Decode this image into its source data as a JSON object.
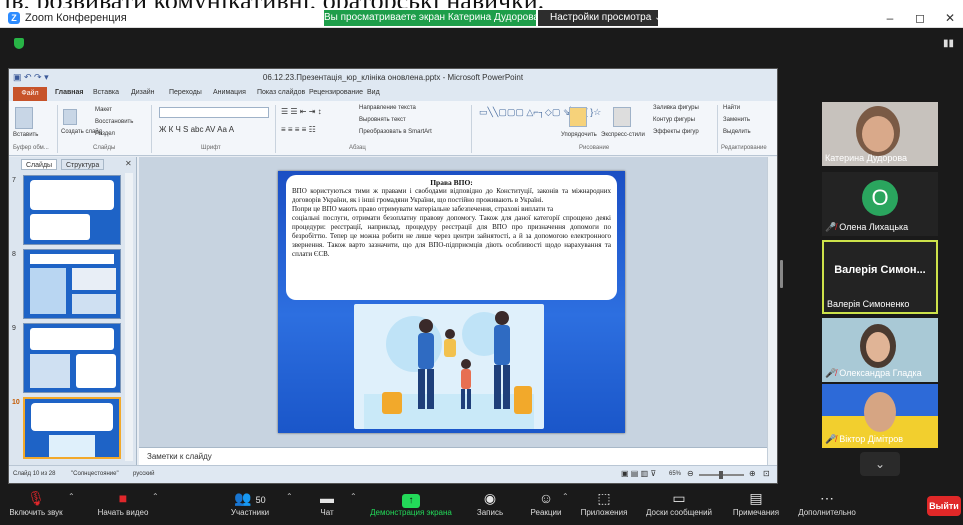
{
  "caption_text": "ів, розвивати комунікативні, ораторські навички.",
  "zoom": {
    "title": "Zoom Конференция",
    "share_banner": "Вы просматриваете экран Катерина Дудорова",
    "view_options": "Настройки просмотра",
    "window_controls": [
      "–",
      "◻",
      "✕"
    ]
  },
  "ppt": {
    "filename": "06.12.23.Презентація_юр_клінікa оновлена.pptx - Microsoft PowerPoint",
    "tabs": [
      "Файл",
      "Главная",
      "Вставка",
      "Дизайн",
      "Переходы",
      "Анимация",
      "Показ слайдов",
      "Рецензирование",
      "Вид"
    ],
    "ribbon": {
      "groups": [
        "Буфер обм...",
        "Слайды",
        "Шрифт",
        "Абзац",
        "Рисование",
        "Редактирование"
      ],
      "items": {
        "paste": "Вставить",
        "create_slide": "Создать слайд",
        "layout": "Макет",
        "reset": "Восстановить",
        "section": "Раздел",
        "text_direction": "Направление текста",
        "align_text": "Выровнять текст",
        "smartart": "Преобразовать в SmartArt",
        "arrange": "Упорядочить",
        "quick_styles": "Экспресс-стили",
        "shape_fill": "Заливка фигуры",
        "shape_outline": "Контур фигуры",
        "shape_effects": "Эффекты фигур",
        "find": "Найти",
        "replace": "Заменить",
        "select": "Выделить"
      }
    },
    "pane_tabs": [
      "Слайды",
      "Структура"
    ],
    "thumb_numbers": [
      "7",
      "8",
      "9",
      "10"
    ],
    "slide": {
      "title": "Права ВПО:",
      "paragraph1": "ВПО користуються тими ж правами і свободами відповідно до Конституції, законів та міжнародних договорів України, як і інші громадяни України, що постійно проживають в Україні.",
      "paragraph2": "Попри це ВПО мають право отримувати матеріальне забезпечення, страхові виплати та",
      "paragraph3": "соціальні послуги, отримати безоплатну правову допомогу. Також для даної категорії спрощено деякі процедури: реєстрації, наприклад, процедуру реєстрації для ВПО про призначення допомоги по безробіттю. Тепер це можна робити не лише через центри зайнятості, а й за допомогою електронного звернення. Також варто зазначити, що для ВПО-підприємців діють особливості щодо нарахування та сплати ЄСВ."
    },
    "notes_placeholder": "Заметки к слайду",
    "status": {
      "slide_counter": "Слайд 10 из 28",
      "theme": "\"Солнцестояние\"",
      "language": "русский",
      "zoom": "65%"
    }
  },
  "participants": [
    {
      "name": "Катерина Дудорова",
      "video": true,
      "muted": false
    },
    {
      "name": "Олена Лихацька",
      "initial": "O",
      "video": false,
      "muted": true
    },
    {
      "name": "Валерія Симоненко",
      "short": "Валерія Симон...",
      "video": false,
      "muted": false,
      "active": true
    },
    {
      "name": "Олександра Гладка",
      "video": true,
      "muted": true
    },
    {
      "name": "Віктор Дімітров",
      "video": true,
      "muted": true
    }
  ],
  "toolbar": {
    "mute": "Включить звук",
    "video": "Начать видео",
    "participants": "Участники",
    "participants_count": "50",
    "chat": "Чат",
    "share": "Демонстрация экрана",
    "record": "Запись",
    "reactions": "Реакции",
    "apps": "Приложения",
    "whiteboards": "Доски сообщений",
    "notes": "Примечания",
    "more": "Дополнительно",
    "leave": "Выйти"
  },
  "colors": {
    "zoom_green": "#1e9e4a",
    "active_speaker": "#cde24a",
    "leave_red": "#e02828",
    "slide_blue": "#1b4fc4",
    "ppt_file_tab": "#c7532a"
  }
}
